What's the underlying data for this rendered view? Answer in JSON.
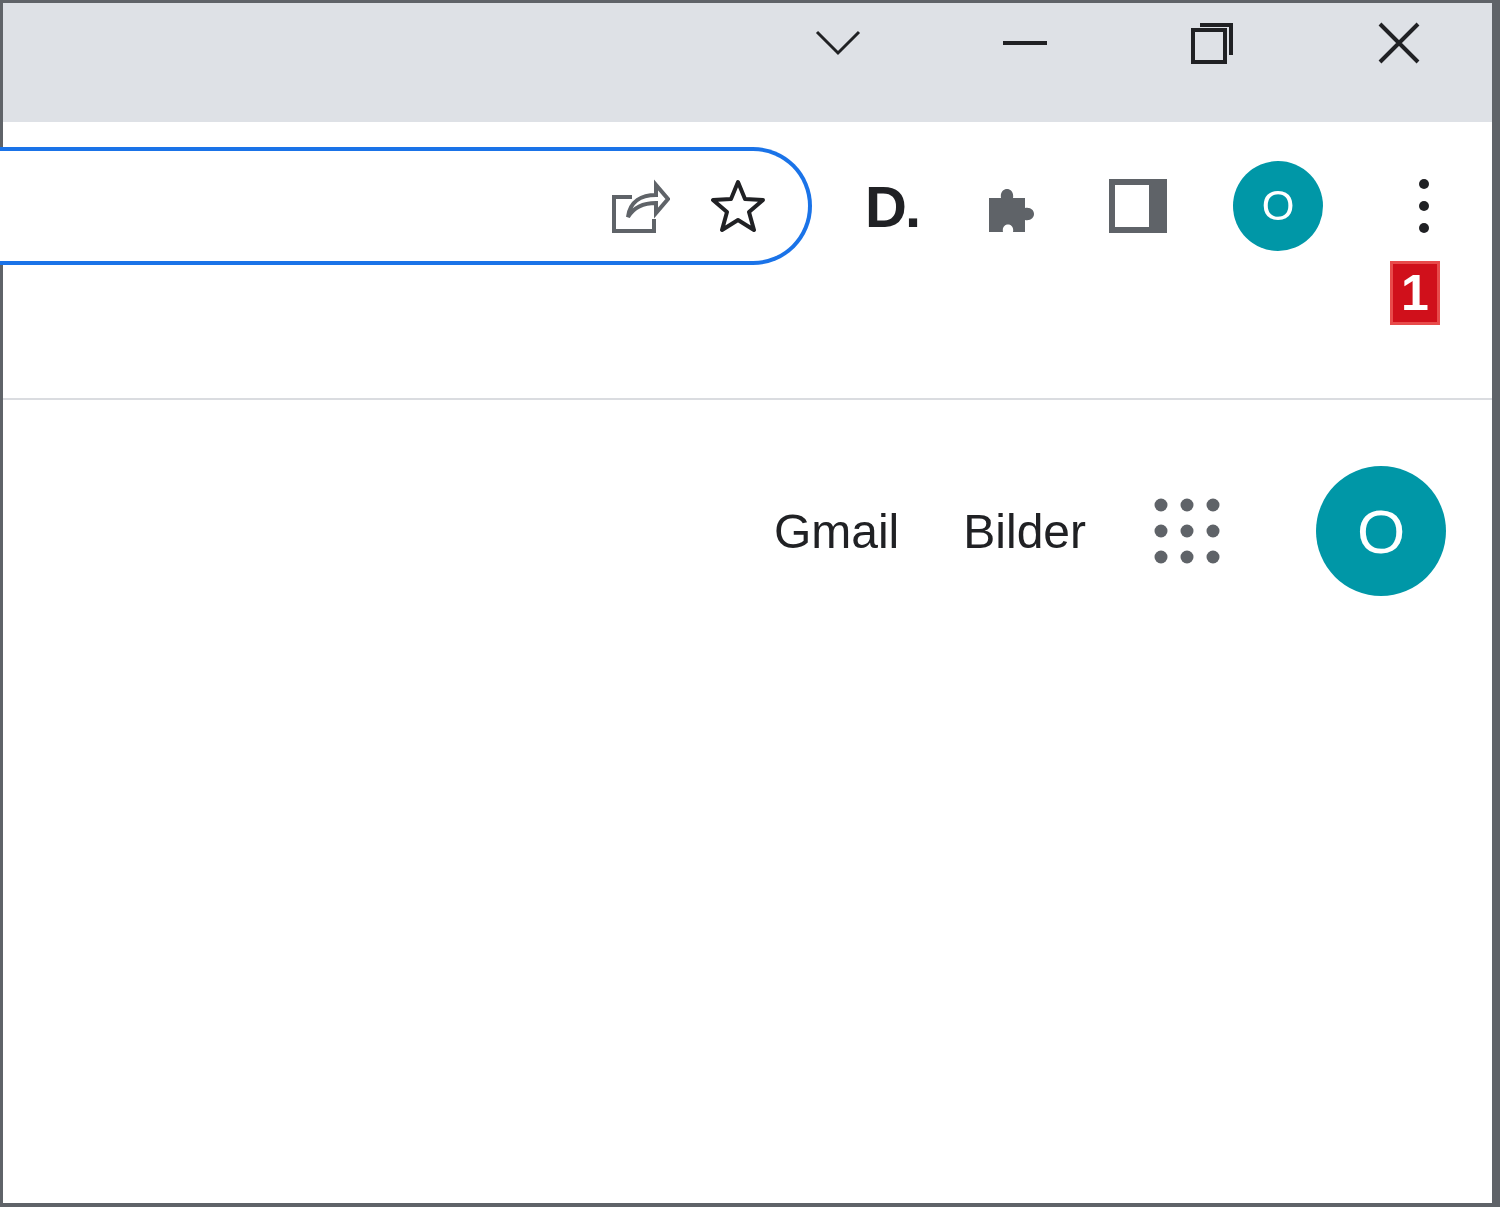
{
  "toolbar": {
    "extension_label": "D.",
    "profile_initial": "O",
    "menu_badge": "1"
  },
  "page_header": {
    "links": [
      "Gmail",
      "Bilder"
    ],
    "account_initial": "O"
  }
}
